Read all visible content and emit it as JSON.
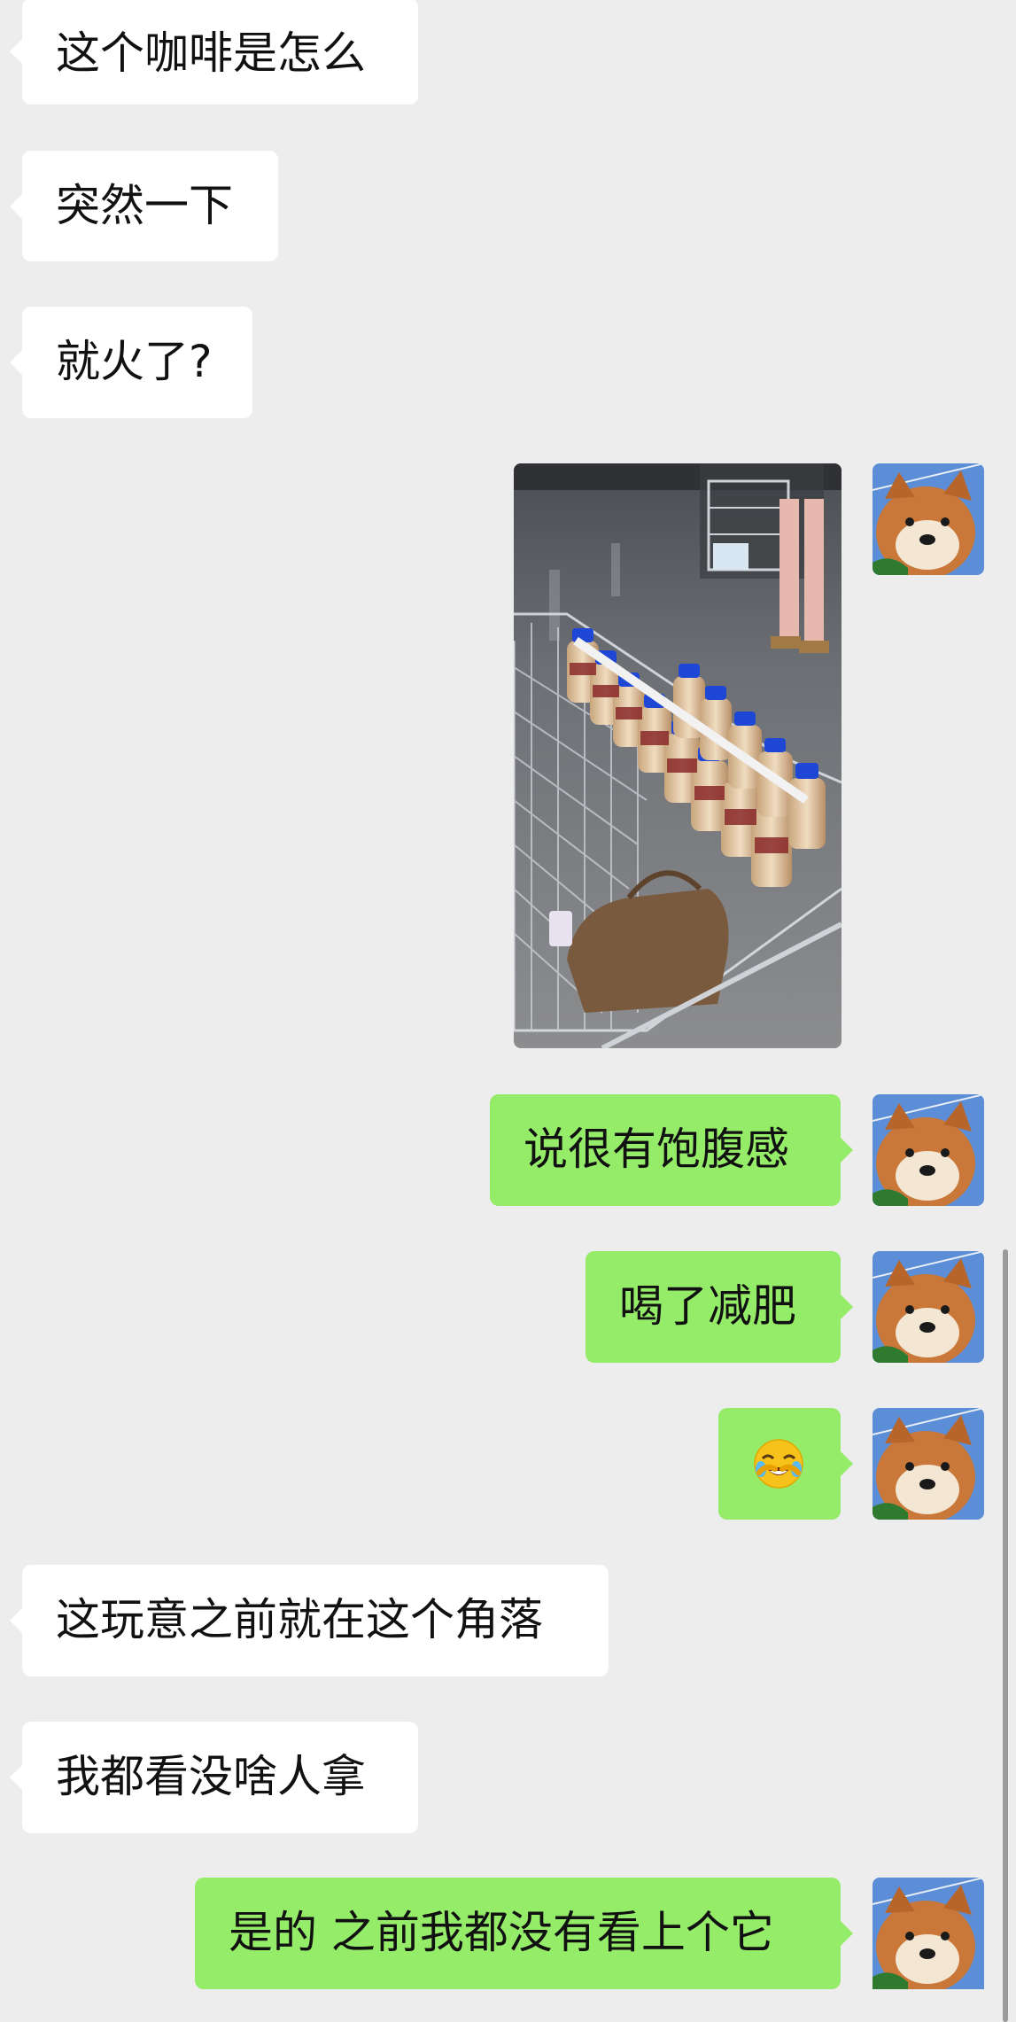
{
  "messages": [
    {
      "side": "in",
      "text": "这个咖啡是怎么"
    },
    {
      "side": "in",
      "text": "突然一下"
    },
    {
      "side": "in",
      "text": "就火了?"
    },
    {
      "side": "out",
      "type": "image",
      "description_icon": "photo-shopping-cart-coffee-bottles"
    },
    {
      "side": "out",
      "text": "说很有饱腹感"
    },
    {
      "side": "out",
      "text": "喝了减肥"
    },
    {
      "side": "out",
      "type": "emoji",
      "emoji": "laughing-crying-face-icon"
    },
    {
      "side": "in",
      "text": "这玩意之前就在这个角落"
    },
    {
      "side": "in",
      "text": "我都看没啥人拿"
    },
    {
      "side": "out",
      "text": "是的 之前我都没有看上个它"
    }
  ],
  "colors": {
    "background": "#ededed",
    "incoming_bubble": "#ffffff",
    "outgoing_bubble": "#95ec69",
    "text": "#111111"
  },
  "avatar": {
    "icon": "shiba-dog-avatar-icon"
  }
}
